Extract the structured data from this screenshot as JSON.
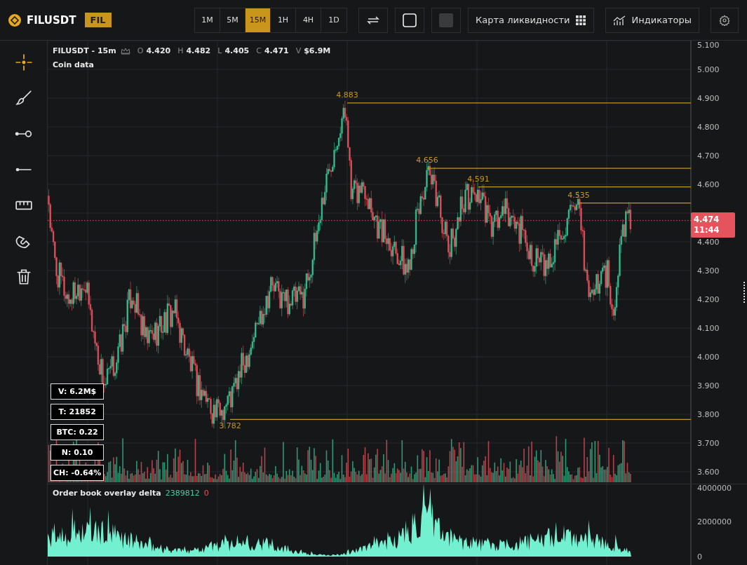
{
  "symbol": {
    "name": "FILUSDT",
    "badge": "FIL"
  },
  "timeframes": [
    {
      "label": "1M",
      "selected": false
    },
    {
      "label": "5M",
      "selected": false
    },
    {
      "label": "15M",
      "selected": true
    },
    {
      "label": "1H",
      "selected": false
    },
    {
      "label": "4H",
      "selected": false
    },
    {
      "label": "1D",
      "selected": false
    }
  ],
  "toolbar_buttons": {
    "liquidity_map": "Карта ликвидности",
    "indicators": "Индикаторы"
  },
  "tools": [
    {
      "kind": "crosshair",
      "selected": true
    },
    {
      "kind": "brush",
      "selected": false
    },
    {
      "kind": "ray",
      "selected": false
    },
    {
      "kind": "line",
      "selected": false
    },
    {
      "kind": "ruler",
      "selected": false
    },
    {
      "kind": "magnet",
      "selected": false
    },
    {
      "kind": "trash",
      "selected": false
    }
  ],
  "chart": {
    "title": "FILUSDT - 15m",
    "ohlc": [
      {
        "label": "O",
        "value": "4.420"
      },
      {
        "label": "H",
        "value": "4.482"
      },
      {
        "label": "L",
        "value": "4.405"
      },
      {
        "label": "C",
        "value": "4.471"
      },
      {
        "label": "V",
        "value": "$6.9M"
      }
    ],
    "subtitle": "Coin data",
    "price_axis": [
      "5.100",
      "5.000",
      "4.900",
      "4.800",
      "4.700",
      "4.600",
      "4.400",
      "4.300",
      "4.200",
      "4.100",
      "4.000",
      "3.900",
      "3.800",
      "3.700",
      "3.600"
    ],
    "levels": [
      {
        "label": "4.883",
        "kind": "high"
      },
      {
        "label": "4.656",
        "kind": "high"
      },
      {
        "label": "4.591",
        "kind": "high"
      },
      {
        "label": "4.535",
        "kind": "high"
      },
      {
        "label": "3.782",
        "kind": "low"
      }
    ],
    "last_price": {
      "price": "4.474",
      "countdown": "11:44"
    },
    "stats": [
      "V: 6.2M$",
      "T: 21852",
      "BTC: 0.22",
      "N: 0.10",
      "CH: -0.64%"
    ]
  },
  "delta": {
    "title": "Order book overlay delta",
    "positive": "2389812",
    "negative": "0",
    "axis": [
      "4000000",
      "2000000",
      "0"
    ]
  }
}
